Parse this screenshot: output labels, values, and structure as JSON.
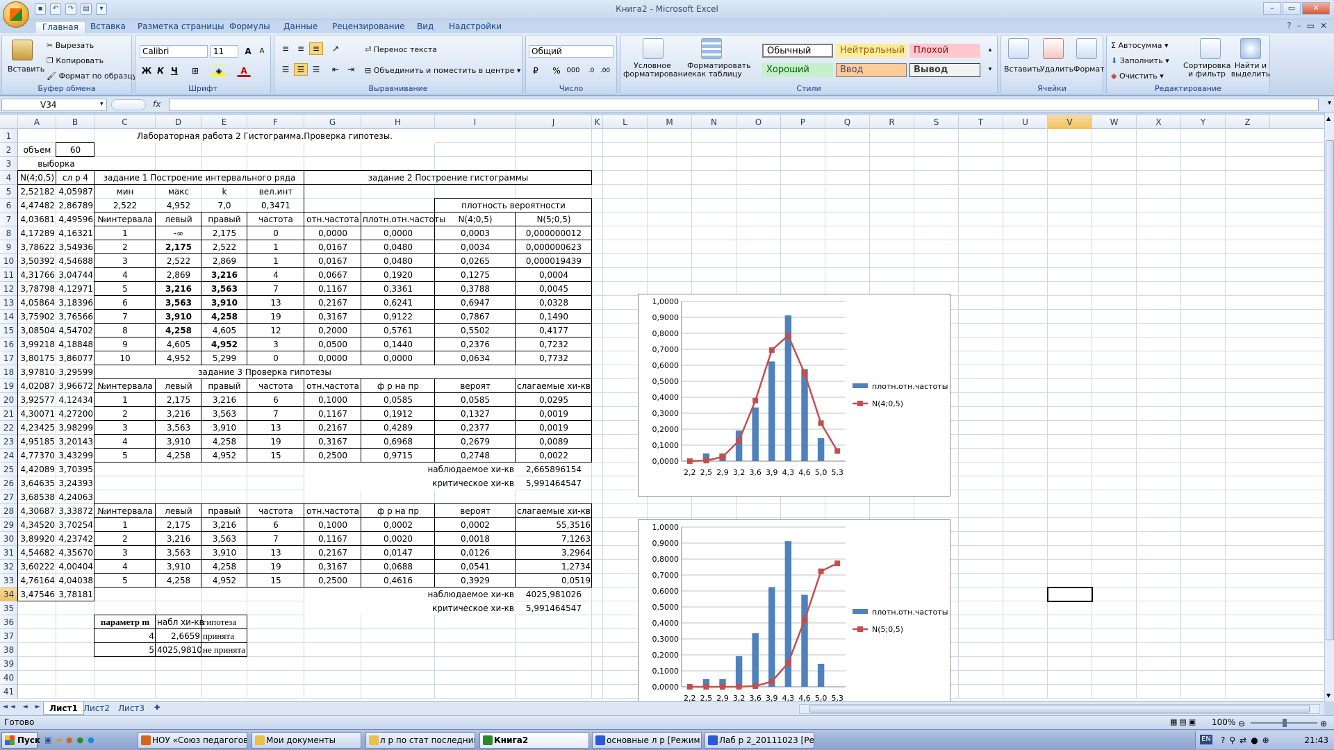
{
  "window": {
    "title": "Книга2 - Microsoft Excel"
  },
  "tabs": [
    "Главная",
    "Вставка",
    "Разметка страницы",
    "Формулы",
    "Данные",
    "Рецензирование",
    "Вид",
    "Надстройки"
  ],
  "ribbon": {
    "clipboard": {
      "paste": "Вставить",
      "cut": "Вырезать",
      "copy": "Копировать",
      "format_painter": "Формат по образцу",
      "label": "Буфер обмена"
    },
    "font": {
      "name": "Calibri",
      "size": "11",
      "label": "Шрифт",
      "bold": "Ж",
      "italic": "К",
      "underline": "Ч"
    },
    "alignment": {
      "wrap": "Перенос текста",
      "merge": "Объединить и поместить в центре",
      "label": "Выравнивание"
    },
    "number": {
      "format": "Общий",
      "label": "Число",
      "percent": "%",
      "thousands": "000"
    },
    "styles": {
      "cond": "Условное форматирование",
      "table": "Форматировать как таблицу",
      "normal": "Обычный",
      "neutral": "Нейтральный",
      "bad": "Плохой",
      "good": "Хороший",
      "input": "Ввод",
      "output": "Вывод",
      "label": "Стили"
    },
    "cells": {
      "insert": "Вставить",
      "delete": "Удалить",
      "format": "Формат",
      "label": "Ячейки"
    },
    "editing": {
      "autosum": "Автосумма",
      "fill": "Заполнить",
      "clear": "Очистить",
      "sort": "Сортировка и фильтр",
      "find": "Найти и выделить",
      "label": "Редактирование"
    }
  },
  "formula_bar": {
    "name_box": "V34",
    "fx": "fx",
    "value": ""
  },
  "columns": [
    "A",
    "B",
    "C",
    "D",
    "E",
    "F",
    "G",
    "H",
    "I",
    "J",
    "K",
    "L",
    "M",
    "N",
    "O",
    "P",
    "Q",
    "R",
    "S",
    "T",
    "U",
    "V",
    "W",
    "X",
    "Y",
    "Z"
  ],
  "rows": [
    "1",
    "2",
    "3",
    "4",
    "5",
    "6",
    "7",
    "8",
    "9",
    "10",
    "11",
    "12",
    "13",
    "14",
    "15",
    "16",
    "17",
    "18",
    "19",
    "20",
    "21",
    "22",
    "23",
    "24",
    "25",
    "26",
    "27",
    "28",
    "29",
    "30",
    "31",
    "32",
    "33",
    "34",
    "35",
    "36",
    "37",
    "38",
    "39",
    "40",
    "41"
  ],
  "sheet": {
    "title": "Лабораторная работа 2 Гистограмма.Проверка гипотезы.",
    "volume_label": "объем",
    "volume": "60",
    "sample_label": "выборка",
    "colA_hdr": "N(4;0,5)",
    "colB_hdr": "сл р 4",
    "task1": "задание 1 Построение интервального ряда",
    "task2": "задание 2 Построение гистограммы",
    "task3": "задание 3 Проверка гипотезы",
    "h_min": "мин",
    "h_max": "макс",
    "h_k": "k",
    "h_int": "вел.инт",
    "v_min": "2,522",
    "v_max": "4,952",
    "v_k": "7,0",
    "v_int": "0,3471",
    "density": "плотность вероятности",
    "hdr7": [
      "№интервала",
      "левый",
      "правый",
      "частота",
      "отн.частота",
      "плотн.отн.частоты",
      "N(4;0,5)",
      "N(5;0,5)"
    ],
    "hdr19": [
      "№интервала",
      "левый",
      "правый",
      "частота",
      "отн.частота",
      "ф р на пр",
      "вероят",
      "слагаемые  хи-кв"
    ],
    "A": [
      "2,52182",
      "4,47482",
      "4,03681",
      "4,17289",
      "3,78622",
      "3,50392",
      "4,31766",
      "3,78798",
      "4,05864",
      "3,75902",
      "3,08504",
      "3,99218",
      "3,80175",
      "3,97810",
      "4,02087",
      "3,92577",
      "4,30071",
      "4,23425",
      "4,95185",
      "4,77370",
      "4,42089",
      "3,64635",
      "3,68538",
      "4,30687",
      "4,34520",
      "3,89920",
      "4,54682",
      "3,60222",
      "4,76164",
      "3,47546"
    ],
    "B": [
      "4,05987",
      "2,86789",
      "4,49596",
      "4,16321",
      "3,54936",
      "4,54688",
      "3,04744",
      "4,12971",
      "3,18396",
      "3,76566",
      "4,54702",
      "4,18848",
      "3,86077",
      "3,29599",
      "3,96672",
      "4,12434",
      "4,27200",
      "3,98299",
      "3,20143",
      "3,43299",
      "3,70395",
      "3,24393",
      "4,24063",
      "3,33872",
      "3,70254",
      "4,23742",
      "4,35670",
      "4,00404",
      "4,04038",
      "3,78181"
    ],
    "t1": [
      [
        "1",
        "-∞",
        "2,175",
        "0",
        "0,0000",
        "0,0000",
        "0,0003",
        "0,000000012"
      ],
      [
        "2",
        "2,175",
        "2,522",
        "1",
        "0,0167",
        "0,0480",
        "0,0034",
        "0,000000623"
      ],
      [
        "3",
        "2,522",
        "2,869",
        "1",
        "0,0167",
        "0,0480",
        "0,0265",
        "0,000019439"
      ],
      [
        "4",
        "2,869",
        "3,216",
        "4",
        "0,0667",
        "0,1920",
        "0,1275",
        "0,0004"
      ],
      [
        "5",
        "3,216",
        "3,563",
        "7",
        "0,1167",
        "0,3361",
        "0,3788",
        "0,0045"
      ],
      [
        "6",
        "3,563",
        "3,910",
        "13",
        "0,2167",
        "0,6241",
        "0,6947",
        "0,0328"
      ],
      [
        "7",
        "3,910",
        "4,258",
        "19",
        "0,3167",
        "0,9122",
        "0,7867",
        "0,1490"
      ],
      [
        "8",
        "4,258",
        "4,605",
        "12",
        "0,2000",
        "0,5761",
        "0,5502",
        "0,4177"
      ],
      [
        "9",
        "4,605",
        "4,952",
        "3",
        "0,0500",
        "0,1440",
        "0,2376",
        "0,7232"
      ],
      [
        "10",
        "4,952",
        "5,299",
        "0",
        "0,0000",
        "0,0000",
        "0,0634",
        "0,7732"
      ]
    ],
    "t2": [
      [
        "1",
        "2,175",
        "3,216",
        "6",
        "0,1000",
        "0,0585",
        "0,0585",
        "0,0295"
      ],
      [
        "2",
        "3,216",
        "3,563",
        "7",
        "0,1167",
        "0,1912",
        "0,1327",
        "0,0019"
      ],
      [
        "3",
        "3,563",
        "3,910",
        "13",
        "0,2167",
        "0,4289",
        "0,2377",
        "0,0019"
      ],
      [
        "4",
        "3,910",
        "4,258",
        "19",
        "0,3167",
        "0,6968",
        "0,2679",
        "0,0089"
      ],
      [
        "5",
        "4,258",
        "4,952",
        "15",
        "0,2500",
        "0,9715",
        "0,2748",
        "0,0022"
      ]
    ],
    "obs_label": "наблюдаемое хи-кв",
    "crit_label": "критическое хи-кв",
    "obs1": "2,665896154",
    "crit1": "5,991464547",
    "t3": [
      [
        "1",
        "2,175",
        "3,216",
        "6",
        "0,1000",
        "0,0002",
        "0,0002",
        "55,3516"
      ],
      [
        "2",
        "3,216",
        "3,563",
        "7",
        "0,1167",
        "0,0020",
        "0,0018",
        "7,1263"
      ],
      [
        "3",
        "3,563",
        "3,910",
        "13",
        "0,2167",
        "0,0147",
        "0,0126",
        "3,2964"
      ],
      [
        "4",
        "3,910",
        "4,258",
        "19",
        "0,3167",
        "0,0688",
        "0,0541",
        "1,2734"
      ],
      [
        "5",
        "4,258",
        "4,952",
        "15",
        "0,2500",
        "0,4616",
        "0,3929",
        "0,0519"
      ]
    ],
    "obs2": "4025,981026",
    "crit2": "5,991464547",
    "summary_hdr": [
      "параметр m",
      "набл хи-кв",
      "гипотеза"
    ],
    "summary": [
      [
        "4",
        "2,6659",
        "принята"
      ],
      [
        "5",
        "4025,9810",
        "не принята"
      ]
    ]
  },
  "chart_data": [
    {
      "type": "bar",
      "categories": [
        "2,2",
        "2,5",
        "2,9",
        "3,2",
        "3,6",
        "3,9",
        "4,3",
        "4,6",
        "5,0",
        "5,3"
      ],
      "series": [
        {
          "name": "плотн.отн.частоты",
          "kind": "bar",
          "color": "#4f81bd",
          "values": [
            0,
            0.048,
            0.048,
            0.192,
            0.3361,
            0.6241,
            0.9122,
            0.5761,
            0.144,
            0
          ]
        },
        {
          "name": "N(4;0,5)",
          "kind": "line",
          "color": "#c0504d",
          "values": [
            0.0003,
            0.0034,
            0.0265,
            0.1275,
            0.3788,
            0.6947,
            0.7867,
            0.5502,
            0.2376,
            0.0634
          ]
        }
      ],
      "yticks": [
        "0,0000",
        "0,1000",
        "0,2000",
        "0,3000",
        "0,4000",
        "0,5000",
        "0,6000",
        "0,7000",
        "0,8000",
        "0,9000",
        "1,0000"
      ],
      "ylim": [
        0,
        1
      ],
      "legend": "right"
    },
    {
      "type": "bar",
      "categories": [
        "2,2",
        "2,5",
        "2,9",
        "3,2",
        "3,6",
        "3,9",
        "4,3",
        "4,6",
        "5,0",
        "5,3"
      ],
      "series": [
        {
          "name": "плотн.отн.частоты",
          "kind": "bar",
          "color": "#4f81bd",
          "values": [
            0,
            0.048,
            0.048,
            0.192,
            0.3361,
            0.6241,
            0.9122,
            0.5761,
            0.144,
            0
          ]
        },
        {
          "name": "N(5;0,5)",
          "kind": "line",
          "color": "#c0504d",
          "values": [
            0,
            0,
            0,
            0.0004,
            0.0045,
            0.0328,
            0.149,
            0.4177,
            0.7232,
            0.7732
          ]
        }
      ],
      "yticks": [
        "0,0000",
        "0,1000",
        "0,2000",
        "0,3000",
        "0,4000",
        "0,5000",
        "0,6000",
        "0,7000",
        "0,8000",
        "0,9000",
        "1,0000"
      ],
      "ylim": [
        0,
        1
      ],
      "legend": "right"
    }
  ],
  "sheet_tabs": [
    "Лист1",
    "Лист2",
    "Лист3"
  ],
  "status": {
    "ready": "Готово",
    "zoom": "100%"
  },
  "taskbar": {
    "start": "Пуск",
    "items": [
      "НОУ «Союз педагогов»...",
      "Мои документы",
      "л р по стат последний в",
      "Книга2",
      "основные л р [Режим с...",
      "Лаб р 2_20111023 [Реж..."
    ],
    "lang": "EN",
    "time": "21:43"
  }
}
